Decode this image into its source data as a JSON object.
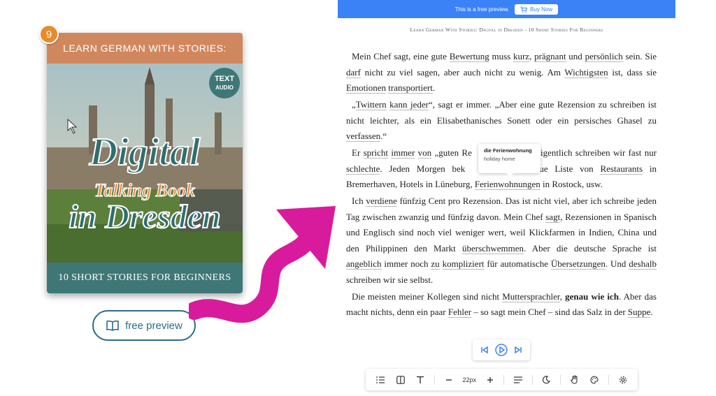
{
  "badge": "9",
  "cover": {
    "top_text": "LEARN GERMAN WITH STORIES:",
    "title_1": "Digital",
    "subtitle": "Talking Book",
    "title_2": "in Dresden",
    "tag_1": "TEXT",
    "tag_2": "AUDIO",
    "bottom_text": "10 SHORT STORIES FOR BEGINNERS"
  },
  "preview_button": {
    "label": "free preview"
  },
  "colors": {
    "accent": "#3b82f6",
    "arrow": "#d81b9c",
    "cover_top": "#d1875e",
    "cover_bottom": "#3f7777",
    "preview_border": "#2d6b8a",
    "badge": "#e88a2b"
  },
  "topbar": {
    "notice": "This is a free preview.",
    "buy_label": "Buy Now"
  },
  "running_head": "Learn German With Stories: Digital in Dresden - 10 Short Stories For Beginners",
  "reader": {
    "p1": {
      "s1": "Mein Chef sagt, eine gute ",
      "w1": "Bewertung",
      "s2": " muss ",
      "w2": "kurz",
      "s3": ", ",
      "w3": "prägnant",
      "s4": " und ",
      "w4": "persönlich",
      "s5": " sein. Sie ",
      "w5": "darf",
      "s6": " nicht zu viel sagen, aber auch nicht zu wenig. Am ",
      "w6": "Wichtigsten",
      "s7": " ist, dass sie ",
      "w7": "Emotionen",
      "s8": " ",
      "w8": "transportiert",
      "s9": "."
    },
    "p2": {
      "s1": "„",
      "w1": "Twittern",
      "s2": " ",
      "w2": "kann jeder",
      "s3": "“, sagt er immer. „Aber eine gute Rezension zu schreiben ist nicht leichter, als ein Elisabethanisches Sonett oder ein persisches Ghasel zu ",
      "w3": "verfassen",
      "s4": ".“"
    },
    "p3": {
      "s1": "Er ",
      "w1": "spricht",
      "s2": " ",
      "w2": "immer",
      "s3": " ",
      "w3": "von",
      "s4": " „guten Re",
      "gap": " ",
      "s5": " eigentlich schreiben wir fast nur ",
      "w4": "schlechte",
      "s6": ". Jeden Morgen bek",
      "s7": " neue Liste von ",
      "w5": "Restaurants",
      "s8": " in Bremerhaven, Hotels in Lüneburg, ",
      "w6": "Ferienwohnungen",
      "s9": " in Rostock, usw."
    },
    "p4": {
      "s1": "Ich ",
      "w1": "verdiene",
      "s2": " fünfzig Cent pro Rezension. Das ist nicht viel, aber ich schreibe jeden Tag zwischen zwanzig und fünfzig davon. Mein Chef ",
      "w2": "sagt",
      "s3": ", Rezensionen in Spanisch und Englisch sind noch viel weniger wert, weil Klickfarmen in Indien, China und den Philippinen den Markt ",
      "w3": "überschwemmen",
      "s4": ". Aber die deutsche Sprache ist ",
      "w4": "angeblich",
      "s5": " immer noch ",
      "w5": "zu",
      "s6": " ",
      "w6": "kompliziert",
      "s7": " für automatische ",
      "w7": "Übersetzungen",
      "s8": ". Und ",
      "w8": "deshalb",
      "s9": " schreiben wir sie selbst."
    },
    "p5": {
      "s1": "Die meisten meiner Kollegen sind nicht ",
      "w1": "Muttersprachler",
      "s2": ", ",
      "b1": "genau wie ich",
      "s3": ". Aber das macht nichts, denn ein paar ",
      "w2": "Fehler",
      "s4": " – so sagt mein Chef – sind das Salz in der ",
      "w3": "Suppe",
      "s5": "."
    }
  },
  "tooltip": {
    "word": "die Ferienwohnung",
    "translation": "holiday home"
  },
  "player": {
    "prev": "skip-back-icon",
    "play": "play-icon",
    "next": "skip-forward-icon"
  },
  "toolbar": {
    "zoom_value": "22px"
  }
}
